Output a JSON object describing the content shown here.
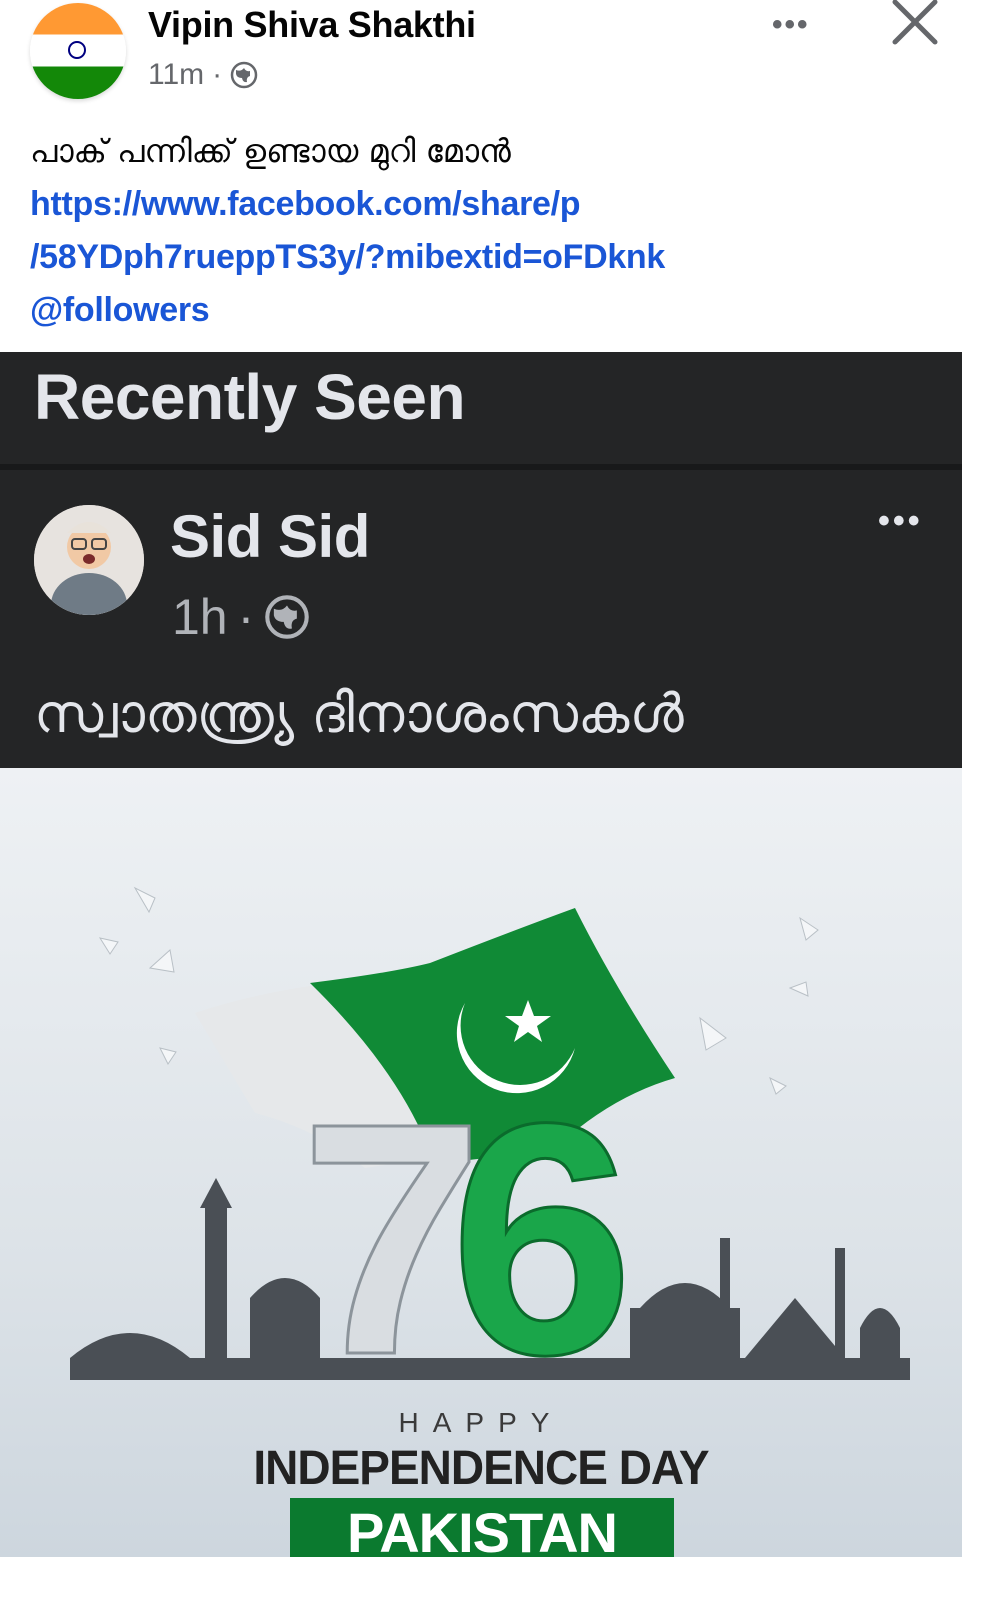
{
  "post": {
    "author": "Vipin Shiva Shakthi",
    "time": "11m",
    "separator": "·",
    "privacy_icon": "globe-icon",
    "more_icon": "more-dots-icon",
    "close_icon": "close-icon",
    "caption_text": "പാക് പന്നിക്ക് ഉണ്ടായ മുറി മോൻ",
    "link_line1": "https://www.facebook.com/share/p",
    "link_line2": "/58YDph7rueppTS3y/?mibextid=oFDknk",
    "mention": "@followers"
  },
  "shared": {
    "section_title": "Recently Seen",
    "author": "Sid Sid",
    "time": "1h",
    "separator": "·",
    "privacy_icon": "globe-icon",
    "text": "സ്വാതന്ത്ര്യ ദിനാശംസകൾ",
    "image": {
      "number": "76",
      "happy": "HAPPY",
      "headline": "INDEPENDENCE DAY",
      "country": "PAKISTAN"
    }
  },
  "colors": {
    "dark_bg": "#242526",
    "link_blue": "#1a56d6",
    "flag_green": "#0b7a2f"
  }
}
